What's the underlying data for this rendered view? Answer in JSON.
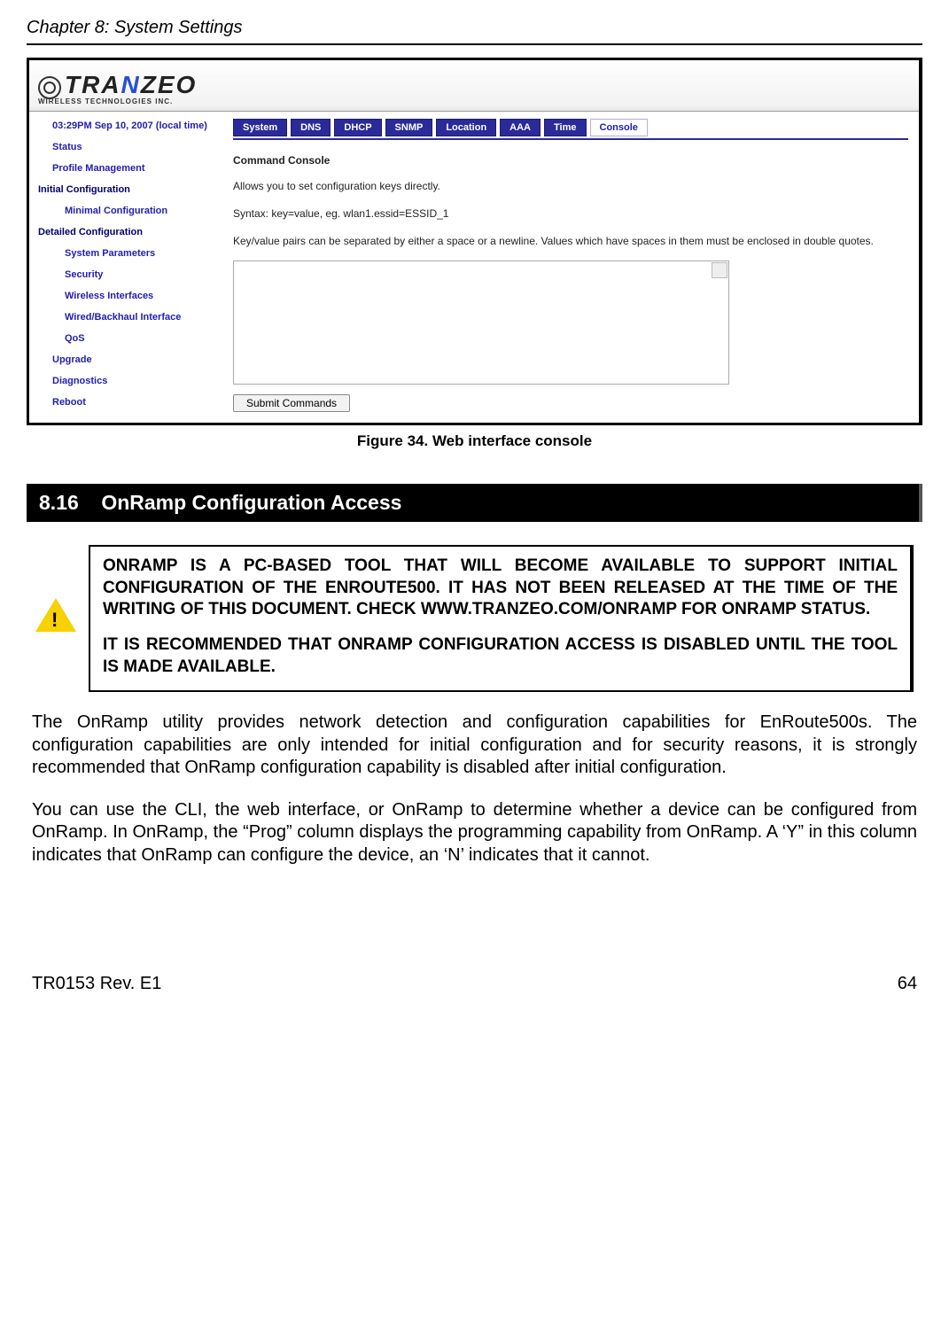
{
  "header": {
    "chapter": "Chapter 8: System Settings"
  },
  "screenshot": {
    "logo": {
      "pre": "TRA",
      "mid": "N",
      "post": "ZEO",
      "sub": "WIRELESS  TECHNOLOGIES INC."
    },
    "sidebar": [
      {
        "label": "03:29PM Sep 10, 2007 (local time)",
        "cls": "ind1"
      },
      {
        "label": "Status",
        "cls": "ind1"
      },
      {
        "label": "Profile Management",
        "cls": "ind1"
      },
      {
        "label": "Initial Configuration",
        "cls": "head"
      },
      {
        "label": "Minimal Configuration",
        "cls": "ind2"
      },
      {
        "label": "Detailed Configuration",
        "cls": "head"
      },
      {
        "label": "System Parameters",
        "cls": "ind2"
      },
      {
        "label": "Security",
        "cls": "ind2"
      },
      {
        "label": "Wireless Interfaces",
        "cls": "ind2"
      },
      {
        "label": "Wired/Backhaul Interface",
        "cls": "ind2"
      },
      {
        "label": "QoS",
        "cls": "ind2"
      },
      {
        "label": "Upgrade",
        "cls": "ind1"
      },
      {
        "label": "Diagnostics",
        "cls": "ind1"
      },
      {
        "label": "Reboot",
        "cls": "ind1"
      }
    ],
    "tabs": [
      {
        "label": "System",
        "active": false
      },
      {
        "label": "DNS",
        "active": false
      },
      {
        "label": "DHCP",
        "active": false
      },
      {
        "label": "SNMP",
        "active": false
      },
      {
        "label": "Location",
        "active": false
      },
      {
        "label": "AAA",
        "active": false
      },
      {
        "label": "Time",
        "active": false
      },
      {
        "label": "Console",
        "active": true
      }
    ],
    "console": {
      "title": "Command Console",
      "line1": "Allows you to set configuration keys directly.",
      "line2": "Syntax: key=value, eg. wlan1.essid=ESSID_1",
      "line3": "Key/value pairs can be separated by either a space or a newline. Values which have spaces in them must be enclosed in double quotes.",
      "textarea_value": "",
      "submit": "Submit Commands"
    }
  },
  "figure_caption": "Figure 34. Web interface console",
  "section": {
    "num": "8.16",
    "title": "OnRamp Configuration Access"
  },
  "note": {
    "p1": "ONRAMP IS A PC-BASED TOOL THAT WILL BECOME AVAILABLE TO SUPPORT INITIAL CONFIGURATION OF THE ENROUTE500. IT HAS NOT BEEN RELEASED AT THE TIME OF THE WRITING OF THIS DOCUMENT. CHECK WWW.TRANZEO.COM/ONRAMP FOR ONRAMP STATUS.",
    "p2": "IT IS RECOMMENDED THAT ONRAMP CONFIGURATION ACCESS IS DISABLED UNTIL THE TOOL IS MADE AVAILABLE."
  },
  "paragraphs": {
    "p1": "The OnRamp utility provides network detection and configuration capabilities for EnRoute500s. The configuration capabilities are only intended for initial configuration and for security reasons, it is strongly recommended that OnRamp configuration capability is disabled after initial configuration.",
    "p2": "You can use the CLI, the web interface, or OnRamp to determine whether a device can be configured from OnRamp. In OnRamp, the “Prog” column displays the programming capability from OnRamp. A ‘Y” in this column indicates that OnRamp can configure the device, an ‘N’ indicates that it cannot."
  },
  "footer": {
    "left": "TR0153 Rev. E1",
    "right": "64"
  }
}
